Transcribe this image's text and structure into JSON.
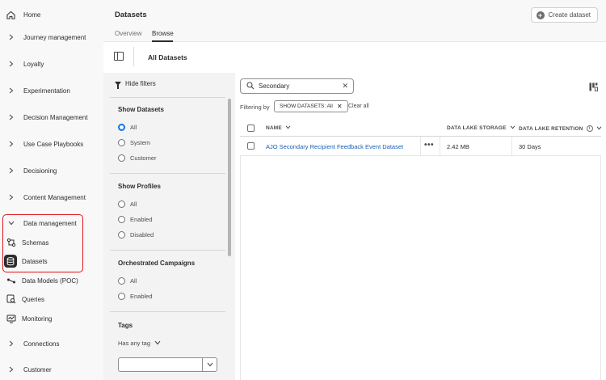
{
  "sidebar": {
    "items": [
      {
        "label": "Home",
        "icon": "home-icon",
        "type": "icon"
      },
      {
        "label": "Journey management",
        "type": "chevron"
      },
      {
        "label": "Loyalty",
        "type": "chevron"
      },
      {
        "label": "Experimentation",
        "type": "chevron"
      },
      {
        "label": "Decision Management",
        "type": "chevron"
      },
      {
        "label": "Use Case Playbooks",
        "type": "chevron"
      },
      {
        "label": "Decisioning",
        "type": "chevron"
      },
      {
        "label": "Content Management",
        "type": "chevron"
      },
      {
        "label": "Data management",
        "type": "chevron-open"
      },
      {
        "label": "Schemas",
        "icon": "schema-icon",
        "type": "icon"
      },
      {
        "label": "Datasets",
        "icon": "database-icon",
        "type": "icon",
        "active": true
      },
      {
        "label": "Data Models (POC)",
        "icon": "data-model-icon",
        "type": "icon"
      },
      {
        "label": "Queries",
        "icon": "query-icon",
        "type": "icon"
      },
      {
        "label": "Monitoring",
        "icon": "monitoring-icon",
        "type": "icon"
      },
      {
        "label": "Connections",
        "type": "chevron"
      },
      {
        "label": "Customer",
        "type": "chevron"
      }
    ]
  },
  "header": {
    "title": "Datasets",
    "create_label": "Create dataset",
    "tabs": [
      {
        "label": "Overview",
        "selected": false
      },
      {
        "label": "Browse",
        "selected": true
      }
    ]
  },
  "subheader": {
    "title": "All Datasets"
  },
  "filters": {
    "hide_label": "Hide filters",
    "groups": [
      {
        "title": "Show Datasets",
        "options": [
          "All",
          "System",
          "Customer"
        ],
        "selected": "All"
      },
      {
        "title": "Show Profiles",
        "options": [
          "All",
          "Enabled",
          "Disabled"
        ],
        "selected": null
      },
      {
        "title": "Orchestrated Campaigns",
        "options": [
          "All",
          "Enabled"
        ],
        "selected": null
      }
    ],
    "tags": {
      "title": "Tags",
      "select_label": "Has any tag",
      "input_value": ""
    }
  },
  "search": {
    "value": "Secondary"
  },
  "filter_bar": {
    "label": "Filtering by",
    "chip": "SHOW DATASETS: All",
    "clear_all": "Clear all"
  },
  "table": {
    "columns": [
      "NAME",
      "DATA LAKE STORAGE",
      "DATA LAKE RETENTION"
    ],
    "rows": [
      {
        "name": "AJO Secondary Recipient Feedback Event Dataset",
        "storage": "2.42 MB",
        "retention": "30 Days"
      }
    ]
  },
  "colors": {
    "accent": "#1473e6",
    "link": "#1660b7",
    "highlight": "#e0141e"
  }
}
